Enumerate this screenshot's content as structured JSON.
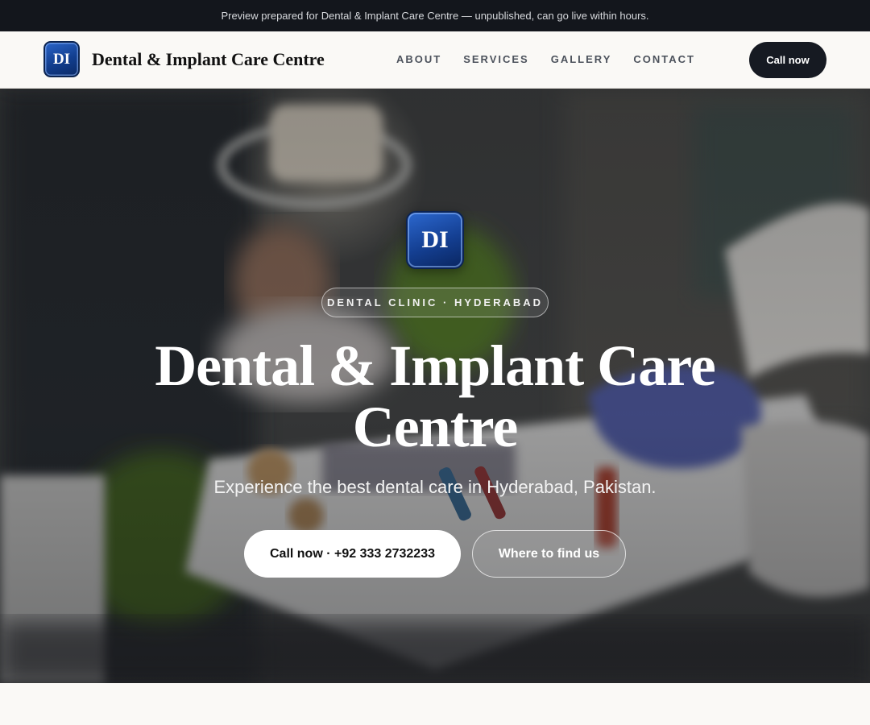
{
  "banner": {
    "text": "Preview prepared for Dental & Implant Care Centre — unpublished, can go live within hours."
  },
  "header": {
    "logo_text": "DI",
    "brand_name": "Dental & Implant Care Centre",
    "nav": [
      {
        "label": "ABOUT"
      },
      {
        "label": "SERVICES"
      },
      {
        "label": "GALLERY"
      },
      {
        "label": "CONTACT"
      }
    ],
    "cta_label": "Call now"
  },
  "hero": {
    "logo_text": "DI",
    "tagline": "DENTAL CLINIC · HYDERABAD",
    "title": "Dental & Implant Care Centre",
    "subtitle": "Experience the best dental care in Hyderabad, Pakistan.",
    "primary_button": "Call now · +92 333 2732233",
    "secondary_button": "Where to find us"
  },
  "colors": {
    "banner_bg": "#13161c",
    "page_bg": "#faf9f6",
    "dark_button": "#161a22",
    "logo_blue": "#143f92"
  }
}
